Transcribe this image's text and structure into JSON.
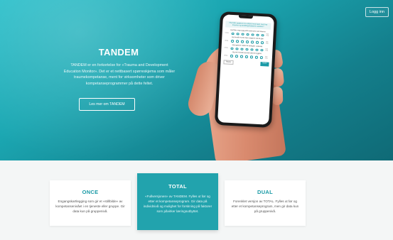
{
  "header": {
    "login_label": "Logg inn"
  },
  "hero": {
    "title": "TANDEM",
    "description": "TANDEM er en forkortelse for «Trauma and Development Education Monitor». Det er et nettbasert spørreskjema som måler traumekompetanse, ment for virksomheter som driver kompetanseprogrammer på dette feltet.",
    "cta_label": "Les mer om TANDEM"
  },
  "phone": {
    "intro": "Hvordan opplever du arbeid med barn som har traumer og utviklingsrelaterte vansker?",
    "questions": [
      {
        "text": "Jeg føler meg trygg på å møte barn med traumer",
        "low": "Uenig",
        "high": "Helt enig"
      },
      {
        "text": "Jeg forstår hvorfor barn reagerer slik de gjør",
        "low": "Uenig",
        "high": "Helt enig"
      },
      {
        "text": "Jeg opplever støtte fra kollegaer i arbeidet",
        "low": "Uenig",
        "high": "Helt enig"
      },
      {
        "text": "Jeg vet hvordan jeg kan bidra til trygghet",
        "low": "Uenig",
        "high": "Helt enig"
      }
    ],
    "back_label": "Tilbake",
    "next_label": "Neste"
  },
  "cards": [
    {
      "title": "ONCE",
      "description": "Engangskartlegging som gir et «stillbilde» av kompetansenivået i en tjeneste eller gruppe. Gir data kun på gruppenivå."
    },
    {
      "title": "TOTAL",
      "description": "«Fullversjonen» av TANDEM. Fylles ut før og etter et kompetanseprogram. Gir data på individnivå og mulighet for forskning på faktorer som påvirker læringsutbyttet."
    },
    {
      "title": "DUAL",
      "description": "Forenklet versjon av TOTAL. Fylles ut før og etter et kompetanseprogram, men gir data kun på gruppenivå."
    }
  ],
  "colors": {
    "accent": "#1a9aa6",
    "hero_gradient_start": "#2bbfca",
    "hero_gradient_end": "#0f6a76",
    "featured_card": "#22a3ad"
  }
}
